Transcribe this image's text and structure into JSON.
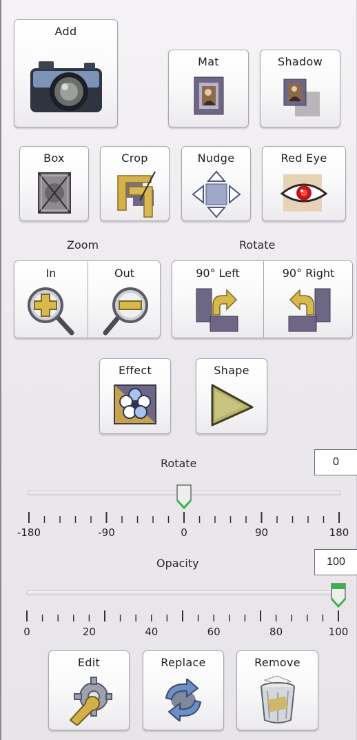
{
  "buttons": {
    "add": "Add",
    "mat": "Mat",
    "shadow": "Shadow",
    "box": "Box",
    "crop": "Crop",
    "nudge": "Nudge",
    "red_eye": "Red Eye",
    "zoom_in": "In",
    "zoom_out": "Out",
    "rotate_left": "90° Left",
    "rotate_right": "90° Right",
    "effect": "Effect",
    "shape": "Shape",
    "edit": "Edit",
    "replace": "Replace",
    "remove": "Remove"
  },
  "groups": {
    "zoom": "Zoom",
    "rotate": "Rotate"
  },
  "rotate_slider": {
    "label": "Rotate",
    "value": "0",
    "min": -180,
    "max": 180,
    "current": 0,
    "tick_labels": [
      "-180",
      "-90",
      "0",
      "90",
      "180"
    ]
  },
  "opacity_slider": {
    "label": "Opacity",
    "value": "100",
    "min": 0,
    "max": 100,
    "current": 100,
    "tick_labels": [
      "0",
      "20",
      "40",
      "60",
      "80",
      "100"
    ]
  },
  "colors": {
    "thumb_accent": "#3cb34a",
    "icon_purple": "#5d5474",
    "icon_gold": "#c9a63a"
  }
}
